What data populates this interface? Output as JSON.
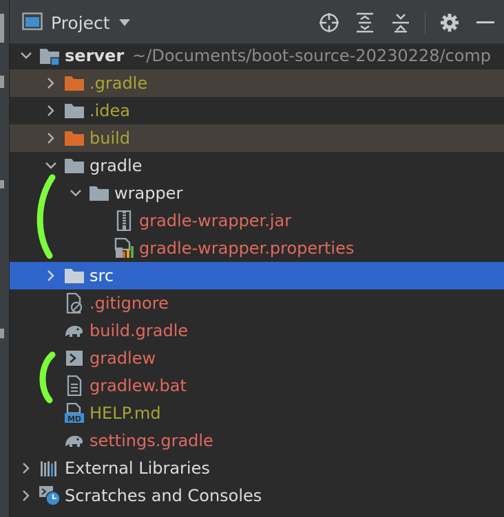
{
  "header": {
    "title": "Project"
  },
  "tree": {
    "root": {
      "name": "server",
      "path": "~/Documents/boot-source-20230228/comp"
    },
    "items": [
      {
        "label": ".gradle",
        "color": "#a6a635",
        "icon": "folder-excluded-icon"
      },
      {
        "label": ".idea",
        "color": "#a6a635",
        "icon": "folder-icon"
      },
      {
        "label": "build",
        "color": "#a6a635",
        "icon": "folder-excluded-icon"
      },
      {
        "label": "gradle",
        "color": "#dcdcdc",
        "icon": "folder-icon"
      },
      {
        "label": "wrapper",
        "color": "#dcdcdc",
        "icon": "folder-icon"
      },
      {
        "label": "gradle-wrapper.jar",
        "color": "#e0695d",
        "icon": "jar-archive-icon"
      },
      {
        "label": "gradle-wrapper.properties",
        "color": "#e0695d",
        "icon": "properties-file-icon"
      },
      {
        "label": "src",
        "color": "#ffffff",
        "icon": "folder-icon"
      },
      {
        "label": ".gitignore",
        "color": "#e0695d",
        "icon": "gitignore-file-icon"
      },
      {
        "label": "build.gradle",
        "color": "#e0695d",
        "icon": "gradle-elephant-icon"
      },
      {
        "label": "gradlew",
        "color": "#e0695d",
        "icon": "shell-script-icon"
      },
      {
        "label": "gradlew.bat",
        "color": "#e0695d",
        "icon": "text-file-icon"
      },
      {
        "label": "HELP.md",
        "color": "#a6a635",
        "icon": "markdown-file-icon"
      },
      {
        "label": "settings.gradle",
        "color": "#e0695d",
        "icon": "gradle-elephant-icon"
      }
    ],
    "external_libraries": "External Libraries",
    "scratches": "Scratches and Consoles"
  },
  "colors": {
    "selection": "#2f65ca",
    "excluded_highlight": "#45403a",
    "annotation_marker": "#7cfc3c"
  }
}
